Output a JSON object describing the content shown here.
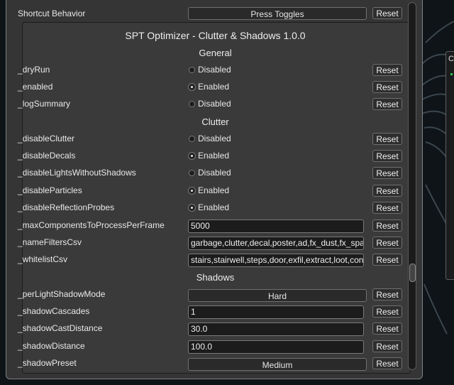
{
  "top": {
    "shortcut_label": "Shortcut Behavior",
    "shortcut_value": "Press Toggles",
    "reset": "Reset"
  },
  "section_title": "SPT Optimizer - Clutter & Shadows 1.0.0",
  "right_widget_letter": "C",
  "headers": {
    "general": "General",
    "clutter": "Clutter",
    "shadows": "Shadows"
  },
  "general": [
    {
      "label": "_dryRun",
      "value": "Disabled",
      "checked": false
    },
    {
      "label": "_enabled",
      "value": "Enabled",
      "checked": true
    },
    {
      "label": "_logSummary",
      "value": "Disabled",
      "checked": false
    }
  ],
  "clutter": [
    {
      "label": "_disableClutter",
      "value": "Disabled",
      "checked": false
    },
    {
      "label": "_disableDecals",
      "value": "Enabled",
      "checked": true
    },
    {
      "label": "_disableLightsWithoutShadows",
      "value": "Disabled",
      "checked": false
    },
    {
      "label": "_disableParticles",
      "value": "Enabled",
      "checked": true
    },
    {
      "label": "_disableReflectionProbes",
      "value": "Enabled",
      "checked": true
    },
    {
      "label": "_maxComponentsToProcessPerFrame",
      "value": "5000"
    },
    {
      "label": "_nameFiltersCsv",
      "value": "garbage,clutter,decal,poster,ad,fx_dust,fx_spa"
    },
    {
      "label": "_whitelistCsv",
      "value": "stairs,stairwell,steps,door,exfil,extract,loot,con"
    }
  ],
  "shadows": [
    {
      "label": "_perLightShadowMode",
      "value": "Hard"
    },
    {
      "label": "_shadowCascades",
      "value": "1"
    },
    {
      "label": "_shadowCastDistance",
      "value": "30.0"
    },
    {
      "label": "_shadowDistance",
      "value": "100.0"
    },
    {
      "label": "_shadowPreset",
      "value": "Medium"
    }
  ],
  "colors": {
    "panel": "#353535",
    "accent_green": "#33c04a"
  }
}
